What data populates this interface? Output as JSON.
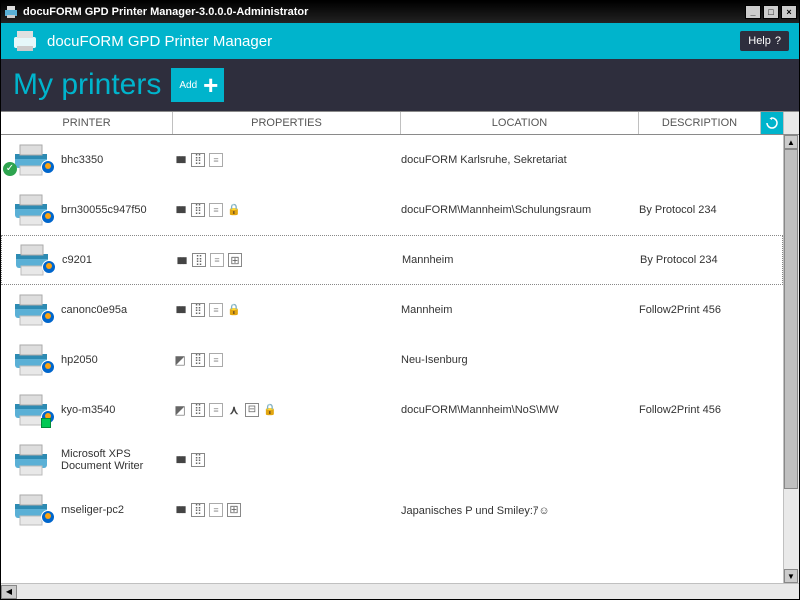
{
  "titlebar": {
    "title": "docuFORM GPD Printer Manager-3.0.0.0-Administrator"
  },
  "header": {
    "appname": "docuFORM GPD Printer Manager",
    "help": "Help"
  },
  "subheader": {
    "pagetitle": "My printers",
    "add_label": "Add"
  },
  "columns": {
    "printer": "PRINTER",
    "properties": "PROPERTIES",
    "location": "LOCATION",
    "description": "DESCRIPTION"
  },
  "rows": [
    {
      "name": "bhc3350",
      "location": "docuFORM Karlsruhe, Sekretariat",
      "description": "",
      "props": [
        "bars",
        "panel",
        "doc"
      ],
      "check": true,
      "selected": false
    },
    {
      "name": "brn30055c947f50",
      "location": "docuFORM\\Mannheim\\Schulungsraum",
      "description": "By Protocol 234",
      "props": [
        "bars",
        "panel",
        "doc",
        "lock"
      ],
      "check": false,
      "selected": false
    },
    {
      "name": "c9201",
      "location": "Mannheim",
      "description": "By Protocol 234",
      "props": [
        "bars",
        "panel",
        "doc",
        "grid"
      ],
      "check": false,
      "selected": true
    },
    {
      "name": "canonc0e95a",
      "location": "Mannheim",
      "description": "Follow2Print 456",
      "props": [
        "bars",
        "panel",
        "doc",
        "lock"
      ],
      "check": false,
      "selected": false
    },
    {
      "name": "hp2050",
      "location": "Neu-Isenburg",
      "description": "",
      "props": [
        "tri",
        "panel",
        "doc"
      ],
      "check": false,
      "selected": false
    },
    {
      "name": "kyo-m3540",
      "location": "docuFORM\\Mannheim\\NoS\\MW",
      "description": "Follow2Print 456",
      "props": [
        "tri",
        "panel",
        "doc",
        "person",
        "building",
        "lock"
      ],
      "check": false,
      "green": true,
      "selected": false
    },
    {
      "name": "Microsoft XPS Document Writer",
      "location": "",
      "description": "",
      "props": [
        "bars",
        "panel"
      ],
      "check": false,
      "nostatus": true,
      "selected": false,
      "fixedwidth": true
    },
    {
      "name": "mseliger-pc2",
      "location": "Japanisches P und Smiley:ｱ☺",
      "description": "",
      "props": [
        "bars",
        "panel",
        "doc",
        "grid"
      ],
      "check": false,
      "selected": false
    }
  ]
}
